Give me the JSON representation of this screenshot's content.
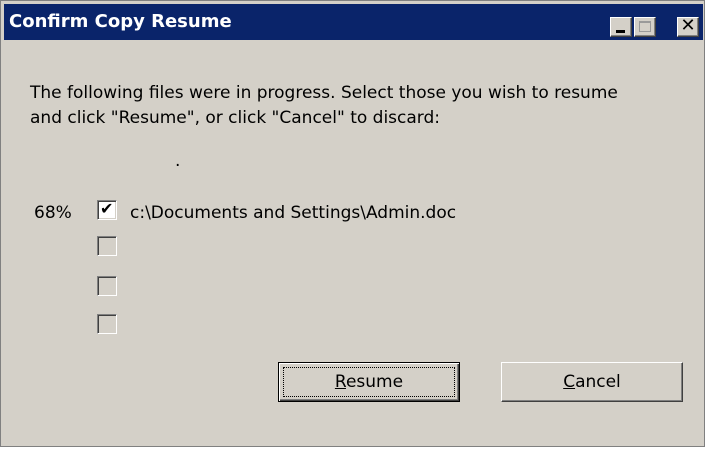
{
  "window": {
    "title": "Confirm Copy Resume",
    "controls": {
      "minimize_icon": "minimize-icon",
      "maximize_icon": "maximize-icon",
      "close_icon": "close-icon",
      "close_glyph": "✕"
    }
  },
  "message": {
    "line1": "The following files were in progress.  Select those you wish to resume",
    "line2": "and click \"Resume\", or click \"Cancel\" to discard:",
    "dot": "."
  },
  "files": [
    {
      "percent": "68%",
      "checked": true,
      "name": "c:\\Documents and Settings\\Admin.doc"
    },
    {
      "percent": "",
      "checked": false,
      "name": ""
    },
    {
      "percent": "",
      "checked": false,
      "name": ""
    },
    {
      "percent": "",
      "checked": false,
      "name": ""
    }
  ],
  "buttons": {
    "resume": {
      "mnemonic": "R",
      "rest": "esume"
    },
    "cancel": {
      "mnemonic": "C",
      "rest": "ancel"
    }
  },
  "colors": {
    "titlebar": "#0a246a",
    "face": "#d4d0c8"
  }
}
